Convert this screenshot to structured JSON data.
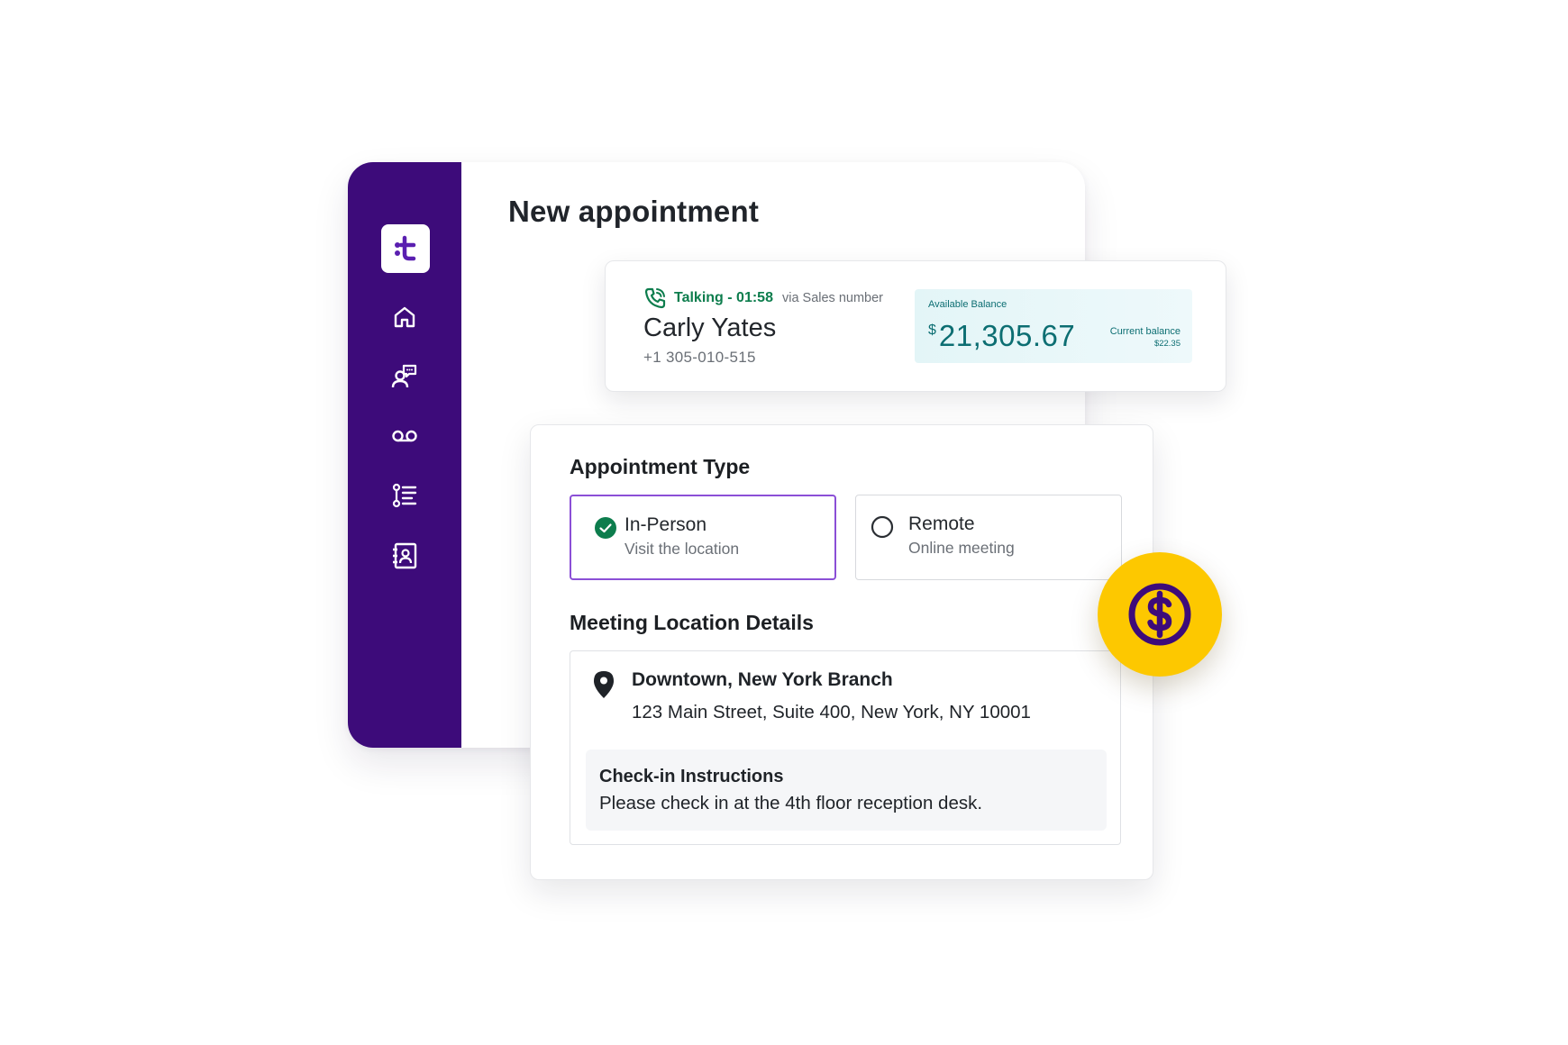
{
  "app": {
    "logo_text": ":t",
    "page_title": "New appointment",
    "nav": [
      "home-icon",
      "contacts-chat-icon",
      "voicemail-icon",
      "list-icon",
      "address-book-icon"
    ]
  },
  "call": {
    "status": "Talking - 01:58",
    "via": "via Sales number",
    "caller_name": "Carly Yates",
    "caller_phone": "+1 305-010-515"
  },
  "balance": {
    "label": "Available Balance",
    "currency": "$",
    "amount": "21,305.67",
    "current_label": "Current balance",
    "current_value": "$22.35"
  },
  "appointment": {
    "type_title": "Appointment Type",
    "options": [
      {
        "title": "In-Person",
        "subtitle": "Visit the location",
        "selected": true
      },
      {
        "title": "Remote",
        "subtitle": "Online meeting",
        "selected": false
      }
    ],
    "location_title": "Meeting Location Details",
    "branch_name": "Downtown, New York Branch",
    "branch_address": "123 Main Street, Suite 400, New York, NY 10001",
    "checkin_title": "Check-in Instructions",
    "checkin_text": "Please check in at the 4th floor reception desk."
  },
  "colors": {
    "sidebar": "#3d0b7a",
    "accent_purple": "#8b4fd6",
    "talk_green": "#0d7d4d",
    "balance_teal": "#0c6e72",
    "badge_yellow": "#fdc800"
  }
}
